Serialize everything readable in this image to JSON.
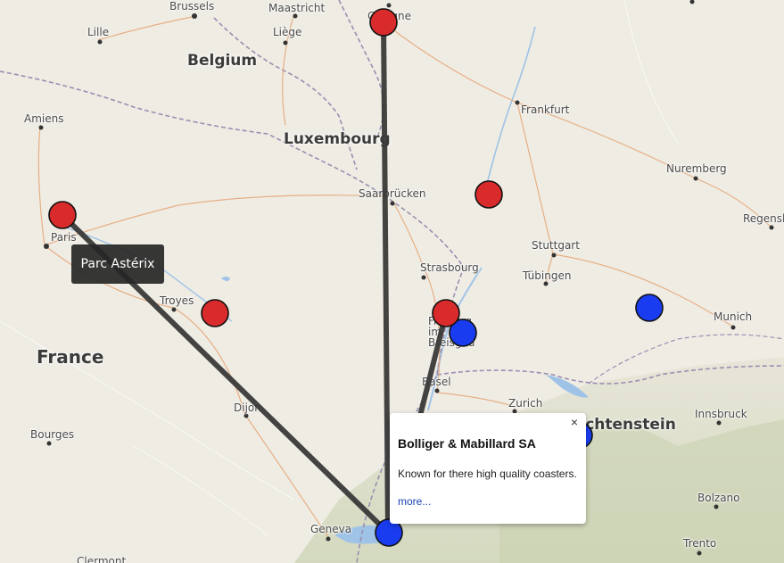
{
  "map": {
    "country_labels": {
      "belgium": "Belgium",
      "luxembourg": "Luxembourg",
      "france": "France",
      "liechtenstein": "Liechtenstein"
    },
    "city_labels": {
      "brussels": "Brussels",
      "maastricht": "Maastricht",
      "lille": "Lille",
      "liege": "Liège",
      "cologne": "Cologne",
      "frankfurt": "Frankfurt",
      "amiens": "Amiens",
      "nuremberg": "Nuremberg",
      "regensburg": "Regensb",
      "saarbrucken": "Saarbrücken",
      "paris": "Paris",
      "stuttgart": "Stuttgart",
      "strasbourg": "Strasbourg",
      "tubingen": "Tübingen",
      "troyes": "Troyes",
      "freiburg": "Freiburg im Breisgau",
      "munich": "Munich",
      "basel": "Basel",
      "zurich": "Zurich",
      "dijon": "Dijon",
      "innsbruck": "Innsbruck",
      "bourges": "Bourges",
      "bolzano": "Bolzano",
      "geneva": "Geneva",
      "trento": "Trento",
      "clermont": "Clermont"
    }
  },
  "tooltip": {
    "text": "Parc Astérix"
  },
  "popup": {
    "close_label": "×",
    "title": "Bolliger & Mabillard SA",
    "description": "Known for there high quality coasters.",
    "link_label": "more..."
  },
  "colors": {
    "park_marker": "#d92b2b",
    "manufacturer_marker": "#1a3cf0",
    "connection_line": "#3a3a3a"
  }
}
